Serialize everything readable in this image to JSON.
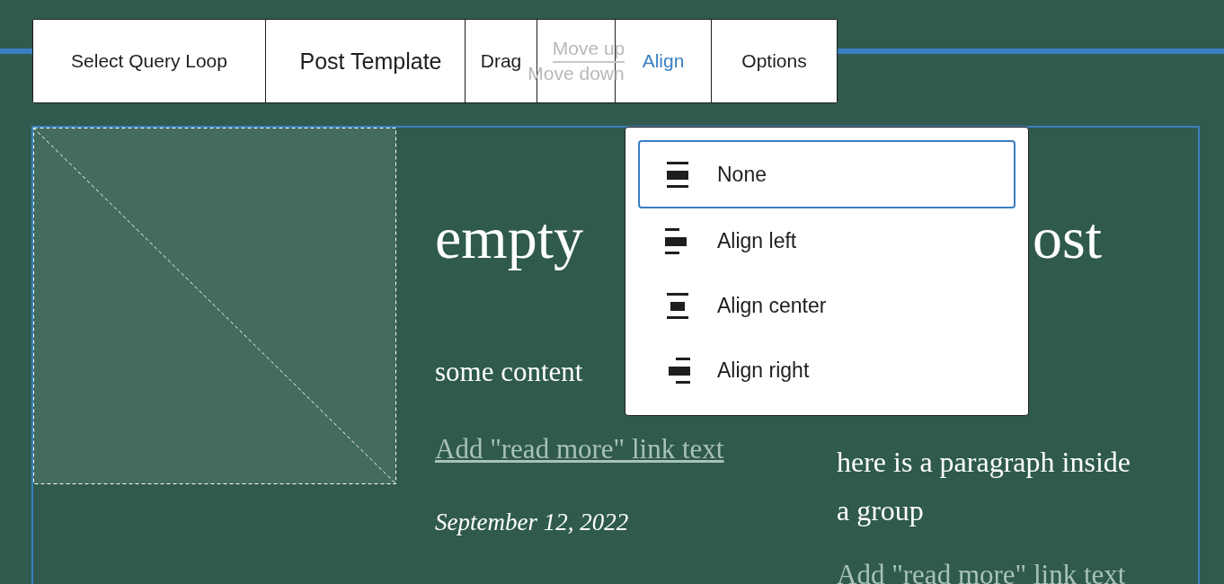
{
  "toolbar": {
    "items": [
      {
        "kind": "button",
        "label": "Select Query Loop"
      },
      {
        "kind": "title",
        "label": "Post Template"
      },
      {
        "kind": "button",
        "label": "Drag"
      },
      {
        "kind": "mover",
        "up": "Move up",
        "down": "Move down",
        "disabled": true
      },
      {
        "kind": "dropdown",
        "label": "Align",
        "expanded": true
      },
      {
        "kind": "dropdown",
        "label": "Options",
        "expanded": false
      }
    ]
  },
  "align_menu": {
    "options": [
      {
        "kind": "none",
        "label": "None",
        "selected": true
      },
      {
        "kind": "left",
        "label": "Align left",
        "selected": false
      },
      {
        "kind": "center",
        "label": "Align center",
        "selected": false
      },
      {
        "kind": "right",
        "label": "Align right",
        "selected": false
      }
    ]
  },
  "post": {
    "heading_parts": [
      "empty",
      "ost"
    ],
    "excerpt": "some content",
    "read_more": "Add \"read more\" link text",
    "date": "September 12, 2022",
    "group": {
      "paragraph": "here is a paragraph inside a group",
      "read_more": "Add \"read more\" link text"
    }
  }
}
